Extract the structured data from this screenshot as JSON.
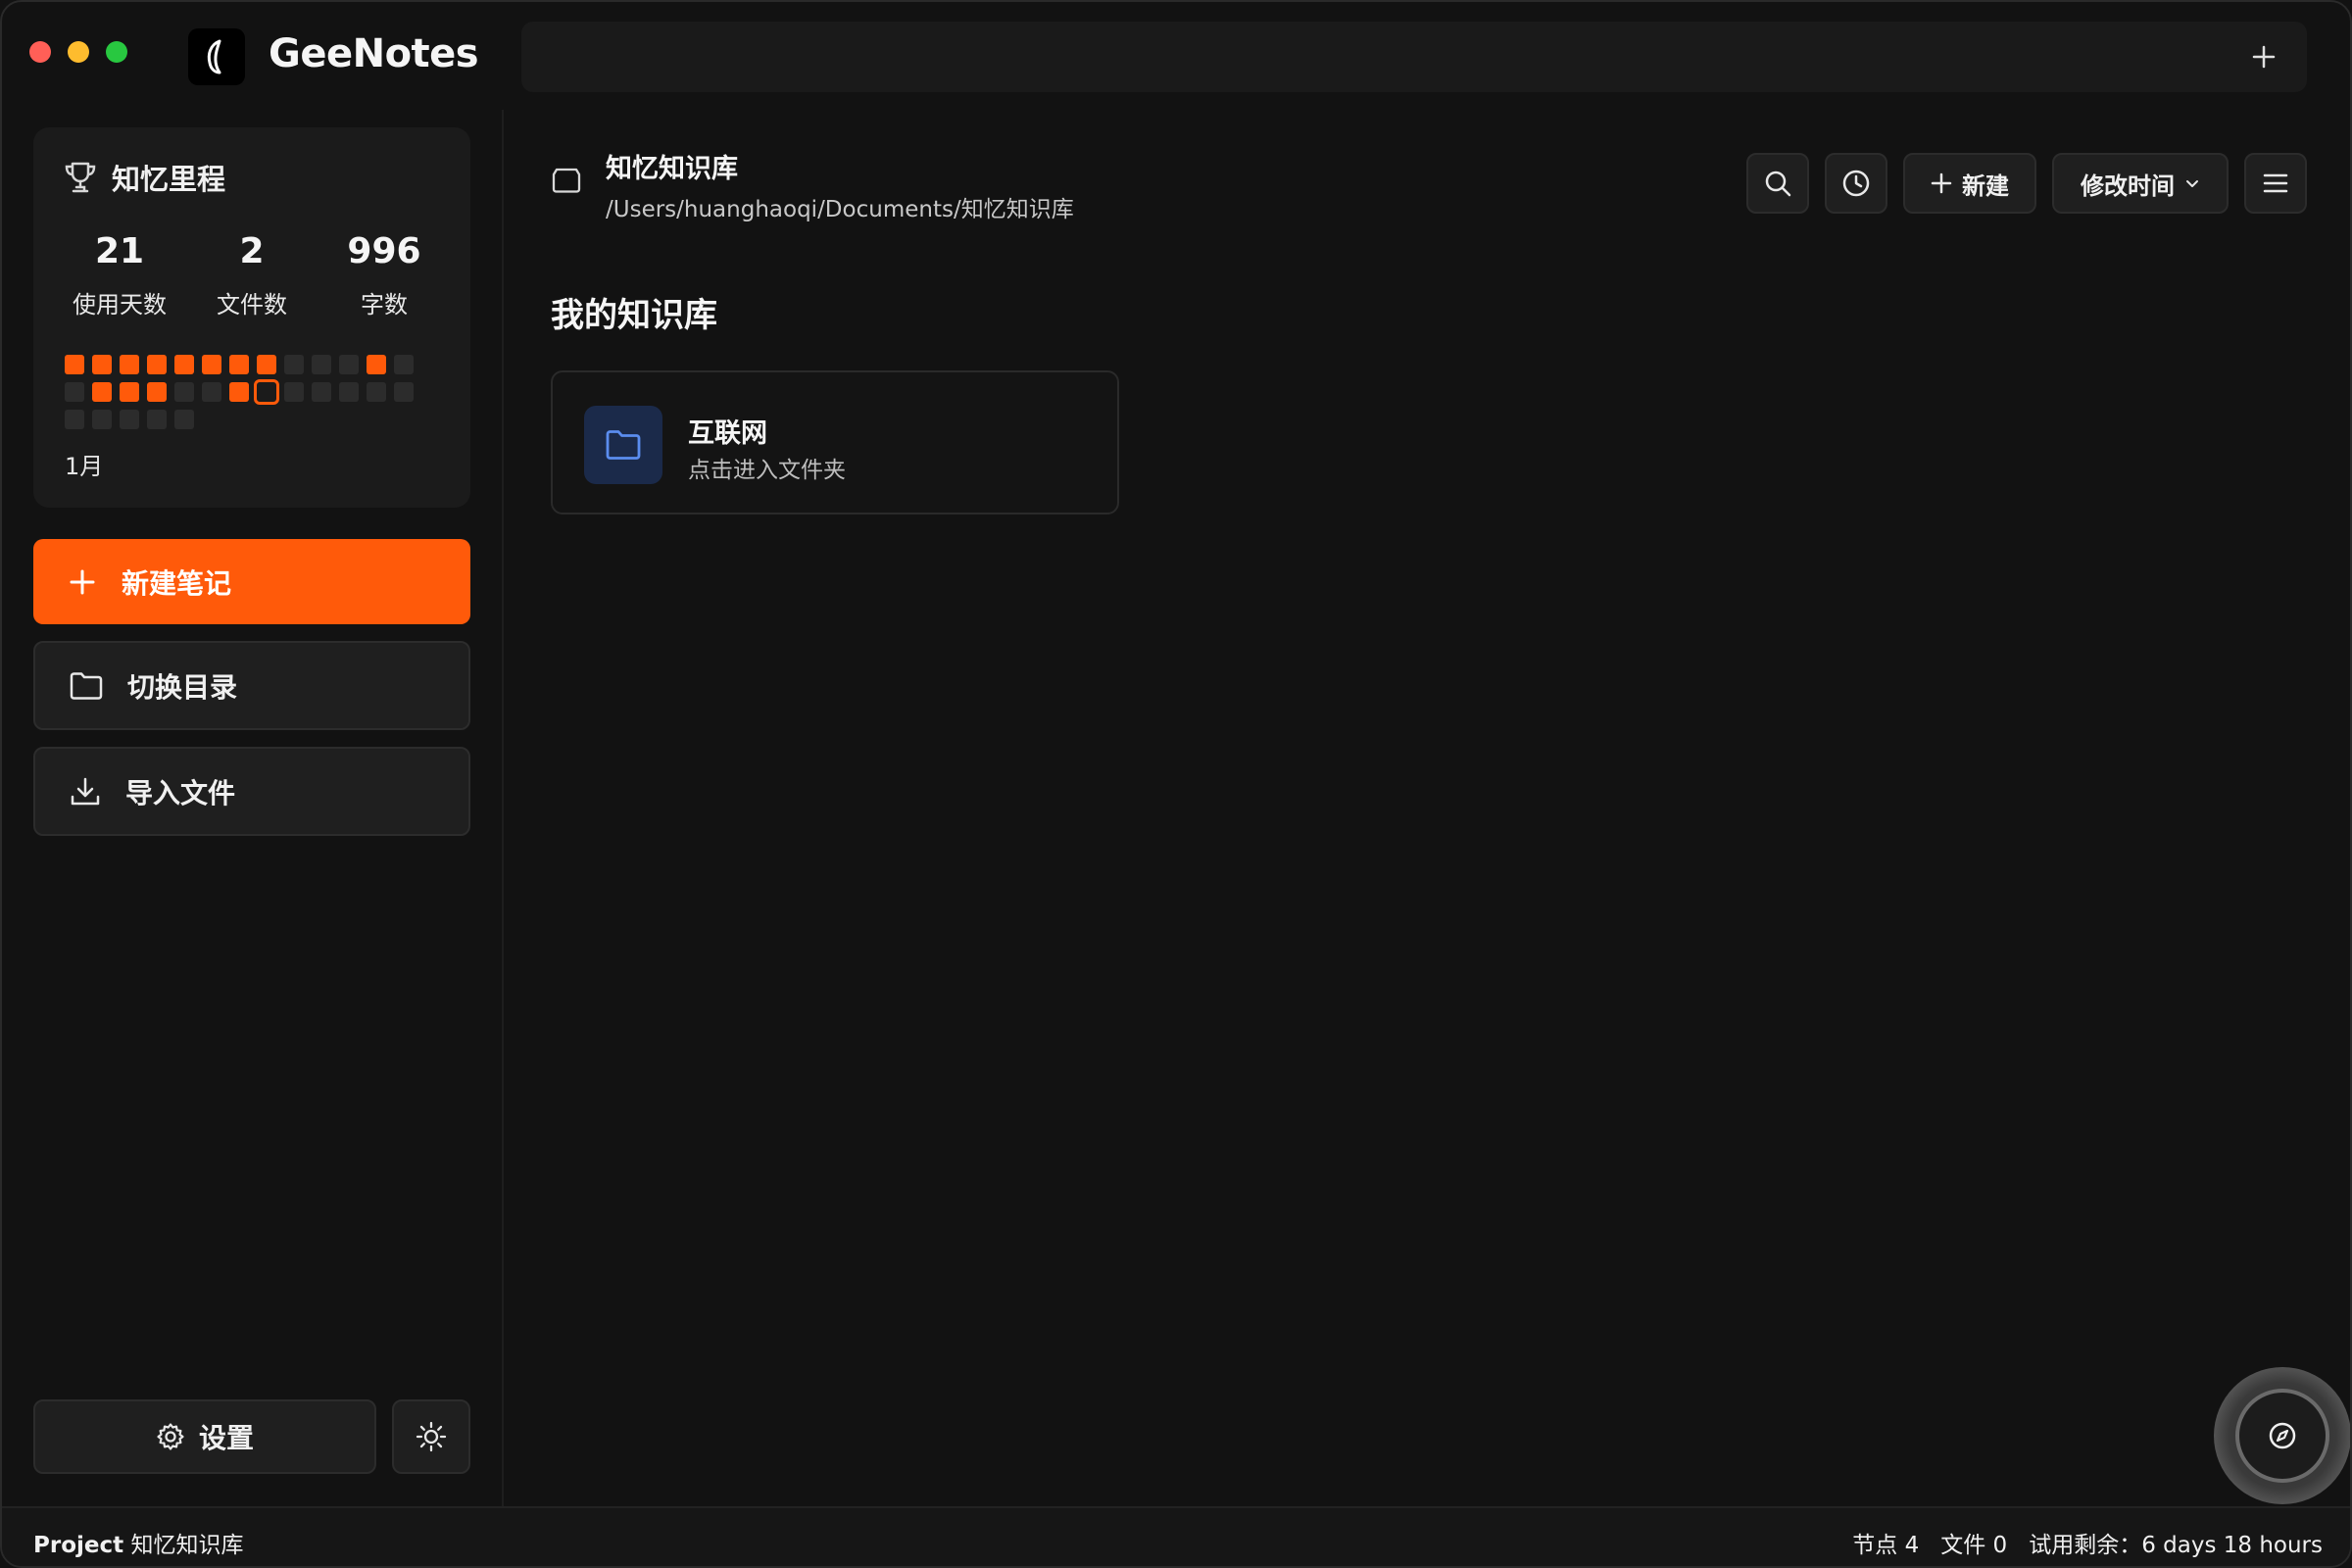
{
  "app": {
    "title": "GeeNotes"
  },
  "stats": {
    "title": "知忆里程",
    "items": [
      {
        "value": "21",
        "label": "使用天数"
      },
      {
        "value": "2",
        "label": "文件数"
      },
      {
        "value": "996",
        "label": "字数"
      }
    ],
    "month": "1月"
  },
  "sidebar": {
    "new_note": "新建笔记",
    "switch_dir": "切换目录",
    "import_file": "导入文件",
    "settings": "设置"
  },
  "header": {
    "kb_name": "知忆知识库",
    "kb_path": "/Users/huanghaoqi/Documents/知忆知识库",
    "new_label": "新建",
    "sort_label": "修改时间"
  },
  "main": {
    "section_title": "我的知识库",
    "folder": {
      "name": "互联网",
      "subtitle": "点击进入文件夹"
    }
  },
  "status": {
    "project_label": "Project",
    "project_name": "知忆知识库",
    "nodes": "节点 4",
    "files": "文件 0",
    "trial": "试用剩余：6 days 18 hours"
  },
  "colors": {
    "accent": "#ff5a0a",
    "folder_bg": "#1b2a4a",
    "folder_icon": "#5b8def"
  }
}
